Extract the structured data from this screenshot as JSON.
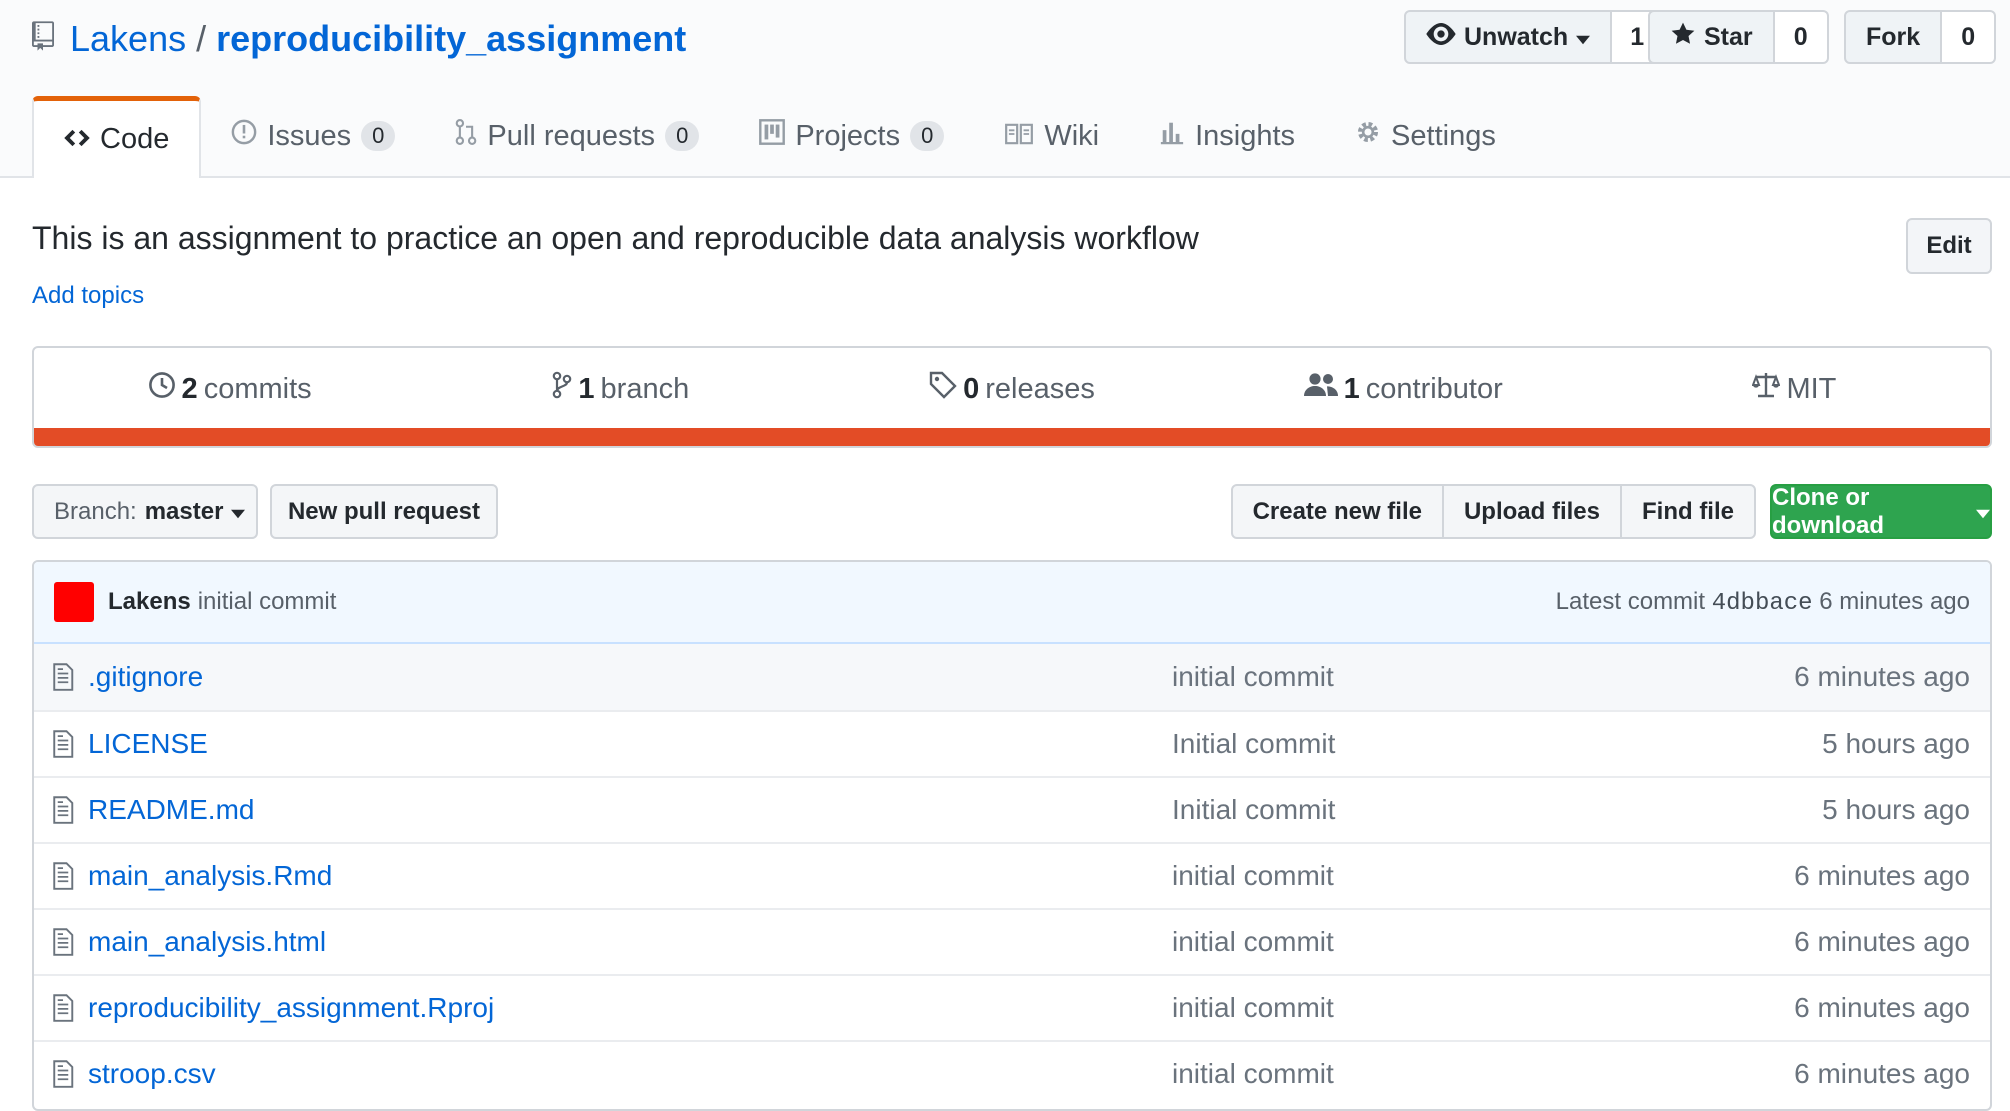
{
  "repo": {
    "owner": "Lakens",
    "separator": "/",
    "name": "reproducibility_assignment"
  },
  "actions": {
    "watch": {
      "label": "Unwatch",
      "count": "1"
    },
    "star": {
      "label": "Star",
      "count": "0"
    },
    "fork": {
      "label": "Fork",
      "count": "0"
    }
  },
  "tabs": [
    {
      "label": "Code",
      "icon": "code-icon",
      "count": ""
    },
    {
      "label": "Issues",
      "icon": "issue-icon",
      "count": "0"
    },
    {
      "label": "Pull requests",
      "icon": "pull-request-icon",
      "count": "0"
    },
    {
      "label": "Projects",
      "icon": "project-icon",
      "count": "0"
    },
    {
      "label": "Wiki",
      "icon": "book-icon",
      "count": ""
    },
    {
      "label": "Insights",
      "icon": "graph-icon",
      "count": ""
    },
    {
      "label": "Settings",
      "icon": "gear-icon",
      "count": ""
    }
  ],
  "description": "This is an assignment to practice an open and reproducible data analysis workflow",
  "add_topics": "Add topics",
  "edit_label": "Edit",
  "summary": {
    "commits": {
      "num": "2",
      "label": "commits"
    },
    "branches": {
      "num": "1",
      "label": "branch"
    },
    "releases": {
      "num": "0",
      "label": "releases"
    },
    "contributors": {
      "num": "1",
      "label": "contributor"
    },
    "license": "MIT",
    "language_color": "#e34c26"
  },
  "toolbar": {
    "branch_prefix": "Branch:",
    "branch_name": "master",
    "new_pr": "New pull request",
    "create_file": "Create new file",
    "upload_files": "Upload files",
    "find_file": "Find file",
    "clone": "Clone or download",
    "clone_color": "#2ea44f"
  },
  "latest_commit": {
    "author": "Lakens",
    "message": "initial commit",
    "prefix": "Latest commit",
    "sha": "4dbbace",
    "time": "6 minutes ago",
    "avatar_color": "#ff0000"
  },
  "files": [
    {
      "name": ".gitignore",
      "message": "initial commit",
      "time": "6 minutes ago"
    },
    {
      "name": "LICENSE",
      "message": "Initial commit",
      "time": "5 hours ago"
    },
    {
      "name": "README.md",
      "message": "Initial commit",
      "time": "5 hours ago"
    },
    {
      "name": "main_analysis.Rmd",
      "message": "initial commit",
      "time": "6 minutes ago"
    },
    {
      "name": "main_analysis.html",
      "message": "initial commit",
      "time": "6 minutes ago"
    },
    {
      "name": "reproducibility_assignment.Rproj",
      "message": "initial commit",
      "time": "6 minutes ago"
    },
    {
      "name": "stroop.csv",
      "message": "initial commit",
      "time": "6 minutes ago"
    }
  ]
}
